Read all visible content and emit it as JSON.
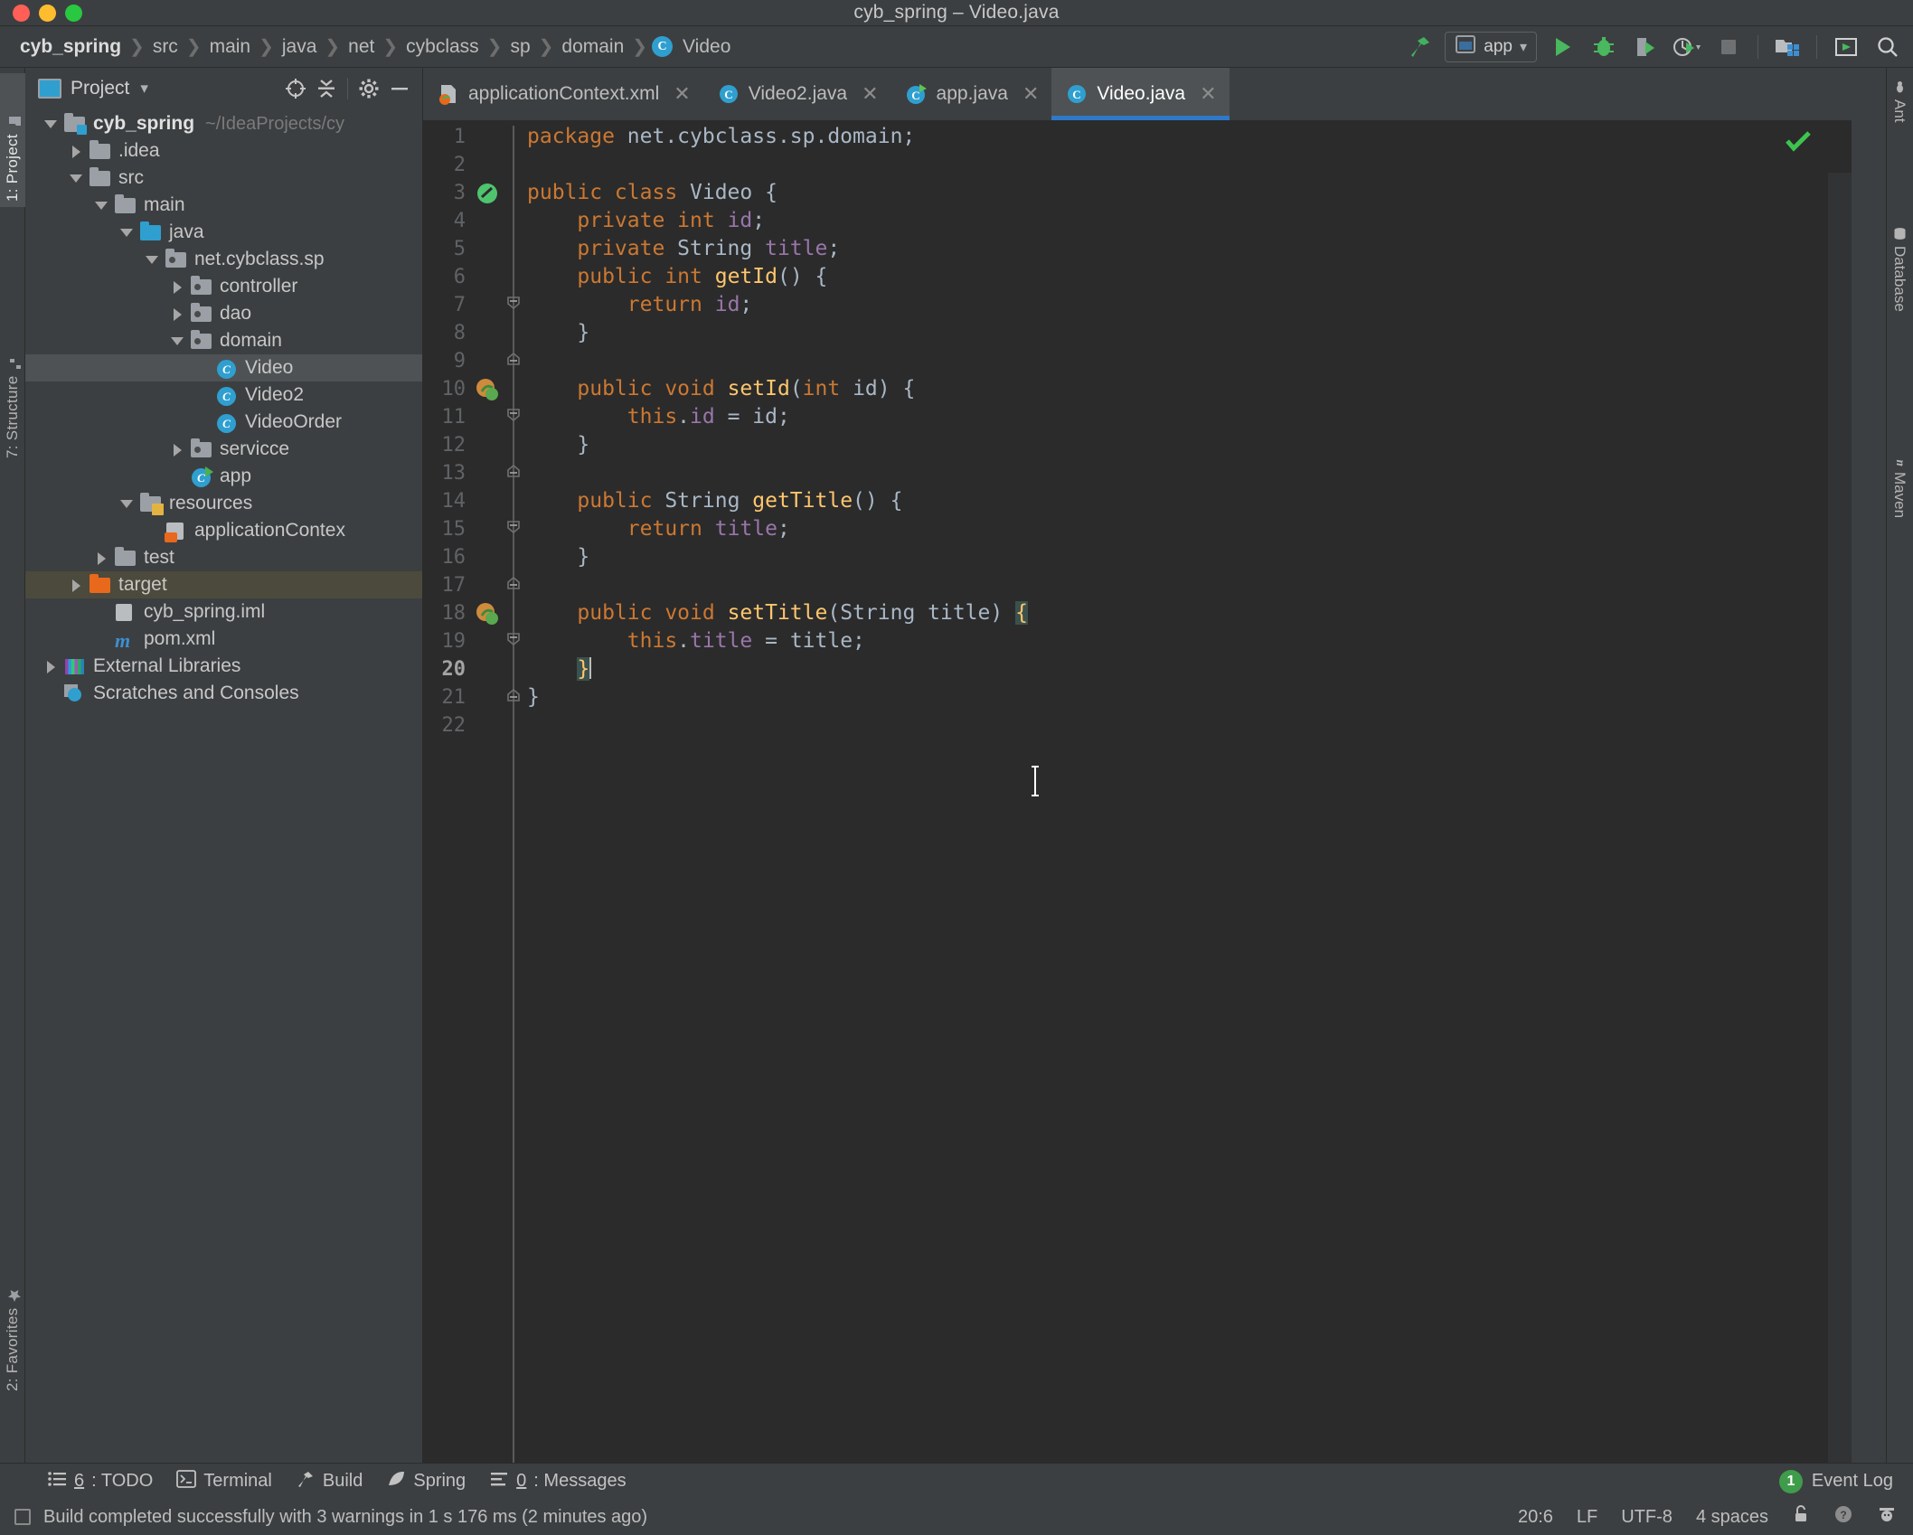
{
  "window": {
    "title": "cyb_spring – Video.java",
    "traffic_lights": [
      "close",
      "minimize",
      "zoom"
    ]
  },
  "breadcrumb": {
    "items": [
      {
        "label": "cyb_spring",
        "root": true
      },
      {
        "label": "src"
      },
      {
        "label": "main"
      },
      {
        "label": "java"
      },
      {
        "label": "net"
      },
      {
        "label": "cybclass"
      },
      {
        "label": "sp"
      },
      {
        "label": "domain"
      },
      {
        "label": "Video",
        "icon": "class-icon",
        "badge": "C"
      }
    ],
    "separator": "❯"
  },
  "toolbar": {
    "build_icon": "hammer-icon",
    "run_config": {
      "label": "app",
      "icon": "run-config-icon",
      "chevron": "▾"
    },
    "run_label": "Run",
    "debug_label": "Debug",
    "run_coverage_label": "Run with Coverage",
    "profile_label": "Profile",
    "stop_label": "Stop",
    "project_structure_label": "Project Structure",
    "updates_label": "Updates",
    "search_label": "Search Everywhere"
  },
  "left_strip": {
    "tabs": [
      {
        "label": "1: Project",
        "active": true,
        "icon": "project-icon"
      },
      {
        "label": "7: Structure",
        "active": false,
        "icon": "structure-icon"
      },
      {
        "label": "2: Favorites",
        "active": false,
        "icon": "star-icon"
      }
    ]
  },
  "right_strip": {
    "tabs": [
      {
        "label": "Ant",
        "icon": "ant-icon"
      },
      {
        "label": "Database",
        "icon": "database-icon"
      },
      {
        "label": "Maven",
        "icon": "maven-icon"
      }
    ]
  },
  "project_panel": {
    "title": "Project",
    "chevron": "▾",
    "actions": [
      "locate-icon",
      "collapse-all-icon",
      "settings-icon",
      "hide-icon"
    ],
    "tree": [
      {
        "label": "cyb_spring",
        "sub": "~/IdeaProjects/cy",
        "depth": 0,
        "arrow": "down",
        "icon": "project-folder",
        "bold": true
      },
      {
        "label": ".idea",
        "depth": 1,
        "arrow": "right",
        "icon": "folder-grey"
      },
      {
        "label": "src",
        "depth": 1,
        "arrow": "down",
        "icon": "folder-grey"
      },
      {
        "label": "main",
        "depth": 2,
        "arrow": "down",
        "icon": "folder-grey"
      },
      {
        "label": "java",
        "depth": 3,
        "arrow": "down",
        "icon": "folder-blue"
      },
      {
        "label": "net.cybclass.sp",
        "depth": 4,
        "arrow": "down",
        "icon": "package"
      },
      {
        "label": "controller",
        "depth": 5,
        "arrow": "right",
        "icon": "package"
      },
      {
        "label": "dao",
        "depth": 5,
        "arrow": "right",
        "icon": "package"
      },
      {
        "label": "domain",
        "depth": 5,
        "arrow": "down",
        "icon": "package"
      },
      {
        "label": "Video",
        "depth": 6,
        "arrow": "none",
        "icon": "java-class",
        "selected": true
      },
      {
        "label": "Video2",
        "depth": 6,
        "arrow": "none",
        "icon": "java-class"
      },
      {
        "label": "VideoOrder",
        "depth": 6,
        "arrow": "none",
        "icon": "java-class"
      },
      {
        "label": "servicce",
        "depth": 5,
        "arrow": "right",
        "icon": "package"
      },
      {
        "label": "app",
        "depth": 5,
        "arrow": "none",
        "icon": "java-class-runnable"
      },
      {
        "label": "resources",
        "depth": 3,
        "arrow": "down",
        "icon": "folder-resources"
      },
      {
        "label": "applicationContex",
        "depth": 4,
        "arrow": "none",
        "icon": "xml-spring"
      },
      {
        "label": "test",
        "depth": 2,
        "arrow": "right",
        "icon": "folder-grey"
      },
      {
        "label": "target",
        "depth": 1,
        "arrow": "right",
        "icon": "folder-orange",
        "highlight": true
      },
      {
        "label": "cyb_spring.iml",
        "depth": 1,
        "arrow": "none",
        "icon": "iml-file"
      },
      {
        "label": "pom.xml",
        "depth": 1,
        "arrow": "none",
        "icon": "maven-file"
      },
      {
        "label": "External Libraries",
        "depth": 0,
        "arrow": "right",
        "icon": "libraries"
      },
      {
        "label": "Scratches and Consoles",
        "depth": 0,
        "arrow": "none",
        "icon": "scratches"
      }
    ]
  },
  "editor": {
    "tabs": [
      {
        "label": "applicationContext.xml",
        "icon": "xml-spring-icon",
        "active": false,
        "close": "✕"
      },
      {
        "label": "Video2.java",
        "icon": "java-class-icon",
        "active": false,
        "close": "✕"
      },
      {
        "label": "app.java",
        "icon": "java-runnable-icon",
        "active": false,
        "close": "✕"
      },
      {
        "label": "Video.java",
        "icon": "java-class-icon",
        "active": true,
        "close": "✕"
      }
    ],
    "inspection_status": "ok-check",
    "lines": [
      {
        "n": 1,
        "tokens": [
          {
            "t": "package",
            "c": "kw"
          },
          {
            "t": " net.cybclass.sp.domain;",
            "c": "pl"
          }
        ],
        "indent": 0
      },
      {
        "n": 2,
        "tokens": [],
        "indent": 0
      },
      {
        "n": 3,
        "tokens": [
          {
            "t": "public class ",
            "c": "kw"
          },
          {
            "t": "Video {",
            "c": "pl"
          }
        ],
        "indent": 0,
        "gutter_icon": "bean-icon"
      },
      {
        "n": 4,
        "tokens": [
          {
            "t": "private int ",
            "c": "kw"
          },
          {
            "t": "id;",
            "c": "fld"
          }
        ],
        "indent": 1
      },
      {
        "n": 5,
        "tokens": [
          {
            "t": "private ",
            "c": "kw"
          },
          {
            "t": "String ",
            "c": "pl"
          },
          {
            "t": "title;",
            "c": "fld"
          }
        ],
        "indent": 1
      },
      {
        "n": 6,
        "tokens": [
          {
            "t": "public int ",
            "c": "kw"
          },
          {
            "t": "getId",
            "c": "fn"
          },
          {
            "t": "() {",
            "c": "pl"
          }
        ],
        "indent": 1,
        "fold": "open"
      },
      {
        "n": 7,
        "tokens": [
          {
            "t": "return ",
            "c": "kw"
          },
          {
            "t": "id;",
            "c": "fld"
          }
        ],
        "indent": 2
      },
      {
        "n": 8,
        "tokens": [
          {
            "t": "}",
            "c": "pl"
          }
        ],
        "indent": 1,
        "fold": "end"
      },
      {
        "n": 9,
        "tokens": [],
        "indent": 0
      },
      {
        "n": 10,
        "tokens": [
          {
            "t": "public void ",
            "c": "kw"
          },
          {
            "t": "setId",
            "c": "fn"
          },
          {
            "t": "(",
            "c": "pl"
          },
          {
            "t": "int ",
            "c": "kw"
          },
          {
            "t": "id) {",
            "c": "pl"
          }
        ],
        "indent": 1,
        "gutter_icon": "bean-override-icon",
        "fold": "open"
      },
      {
        "n": 11,
        "tokens": [
          {
            "t": "this",
            "c": "kw"
          },
          {
            "t": ".",
            "c": "pl"
          },
          {
            "t": "id",
            "c": "fld"
          },
          {
            "t": " = id;",
            "c": "pl"
          }
        ],
        "indent": 2
      },
      {
        "n": 12,
        "tokens": [
          {
            "t": "}",
            "c": "pl"
          }
        ],
        "indent": 1,
        "fold": "end"
      },
      {
        "n": 13,
        "tokens": [],
        "indent": 0
      },
      {
        "n": 14,
        "tokens": [
          {
            "t": "public ",
            "c": "kw"
          },
          {
            "t": "String ",
            "c": "pl"
          },
          {
            "t": "getTitle",
            "c": "fn"
          },
          {
            "t": "() {",
            "c": "pl"
          }
        ],
        "indent": 1,
        "fold": "open"
      },
      {
        "n": 15,
        "tokens": [
          {
            "t": "return ",
            "c": "kw"
          },
          {
            "t": "title;",
            "c": "fld"
          }
        ],
        "indent": 2
      },
      {
        "n": 16,
        "tokens": [
          {
            "t": "}",
            "c": "pl"
          }
        ],
        "indent": 1,
        "fold": "end"
      },
      {
        "n": 17,
        "tokens": [],
        "indent": 0
      },
      {
        "n": 18,
        "tokens": [
          {
            "t": "public void ",
            "c": "kw"
          },
          {
            "t": "setTitle",
            "c": "fn"
          },
          {
            "t": "(",
            "c": "pl"
          },
          {
            "t": "String ",
            "c": "pl"
          },
          {
            "t": "title) ",
            "c": "pl"
          },
          {
            "t": "{",
            "c": "hl"
          }
        ],
        "indent": 1,
        "gutter_icon": "bean-override-icon",
        "fold": "open"
      },
      {
        "n": 19,
        "tokens": [
          {
            "t": "this",
            "c": "kw"
          },
          {
            "t": ".",
            "c": "pl"
          },
          {
            "t": "title",
            "c": "fld"
          },
          {
            "t": " = title;",
            "c": "pl"
          }
        ],
        "indent": 2
      },
      {
        "n": 20,
        "tokens": [
          {
            "t": "}",
            "c": "hl"
          }
        ],
        "indent": 1,
        "fold": "end",
        "current": true,
        "caret": true
      },
      {
        "n": 21,
        "tokens": [
          {
            "t": "}",
            "c": "pl"
          }
        ],
        "indent": 0
      },
      {
        "n": 22,
        "tokens": [],
        "indent": 0
      }
    ]
  },
  "bottom_bar": {
    "items": [
      {
        "num": "6",
        "label": ": TODO",
        "icon": "todo-icon"
      },
      {
        "num": "",
        "label": "Terminal",
        "icon": "terminal-icon"
      },
      {
        "num": "",
        "label": "Build",
        "icon": "hammer-icon"
      },
      {
        "num": "",
        "label": "Spring",
        "icon": "spring-leaf-icon"
      },
      {
        "num": "0",
        "label": ": Messages",
        "icon": "messages-icon"
      }
    ],
    "event_log": {
      "count": "1",
      "label": "Event Log"
    }
  },
  "status_bar": {
    "message": "Build completed successfully with 3 warnings in 1 s 176 ms (2 minutes ago)",
    "position": "20:6",
    "line_sep": "LF",
    "encoding": "UTF-8",
    "indent": "4 spaces",
    "icons": [
      "lock-icon",
      "inspection-icon",
      "face-icon"
    ]
  },
  "colors": {
    "accent_blue": "#2f79c8",
    "panel_bg": "#3c3f41",
    "editor_bg": "#2b2b2b",
    "keyword": "#cc7832",
    "field": "#9876aa",
    "method": "#ffc66d",
    "plain": "#a9b7c6",
    "selection": "#4e5254",
    "orange_folder": "#e8681c"
  }
}
